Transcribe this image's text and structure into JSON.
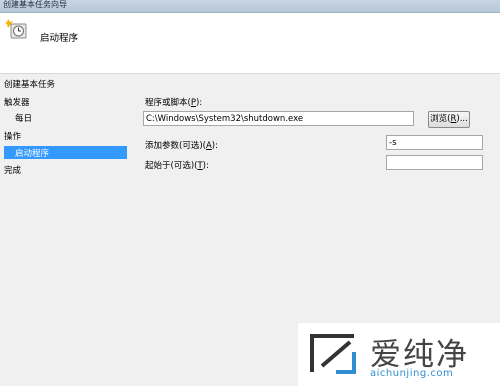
{
  "window": {
    "title": "创建基本任务向导"
  },
  "header": {
    "title": "启动程序"
  },
  "nav": {
    "items": [
      {
        "label": "创建基本任务"
      },
      {
        "label": "触发器"
      },
      {
        "label": "每日"
      },
      {
        "label": "操作"
      },
      {
        "label": "启动程序"
      },
      {
        "label": "完成"
      }
    ]
  },
  "form": {
    "program_label": "程序或脚本(",
    "program_key": "P",
    "program_label_end": "):",
    "program_value": "C:\\Windows\\System32\\shutdown.exe",
    "browse_label": "浏览(",
    "browse_key": "R",
    "browse_label_end": ")...",
    "args_label": "添加参数(可选)(",
    "args_key": "A",
    "args_label_end": "):",
    "args_value": "-s",
    "start_label": "起始于(可选)(",
    "start_key": "T",
    "start_label_end": "):",
    "start_value": ""
  },
  "watermark": {
    "text": "爱纯净",
    "url": "aichunjing.com"
  },
  "colors": {
    "selection": "#3399ff",
    "watermark_url": "#2f8fd0"
  }
}
